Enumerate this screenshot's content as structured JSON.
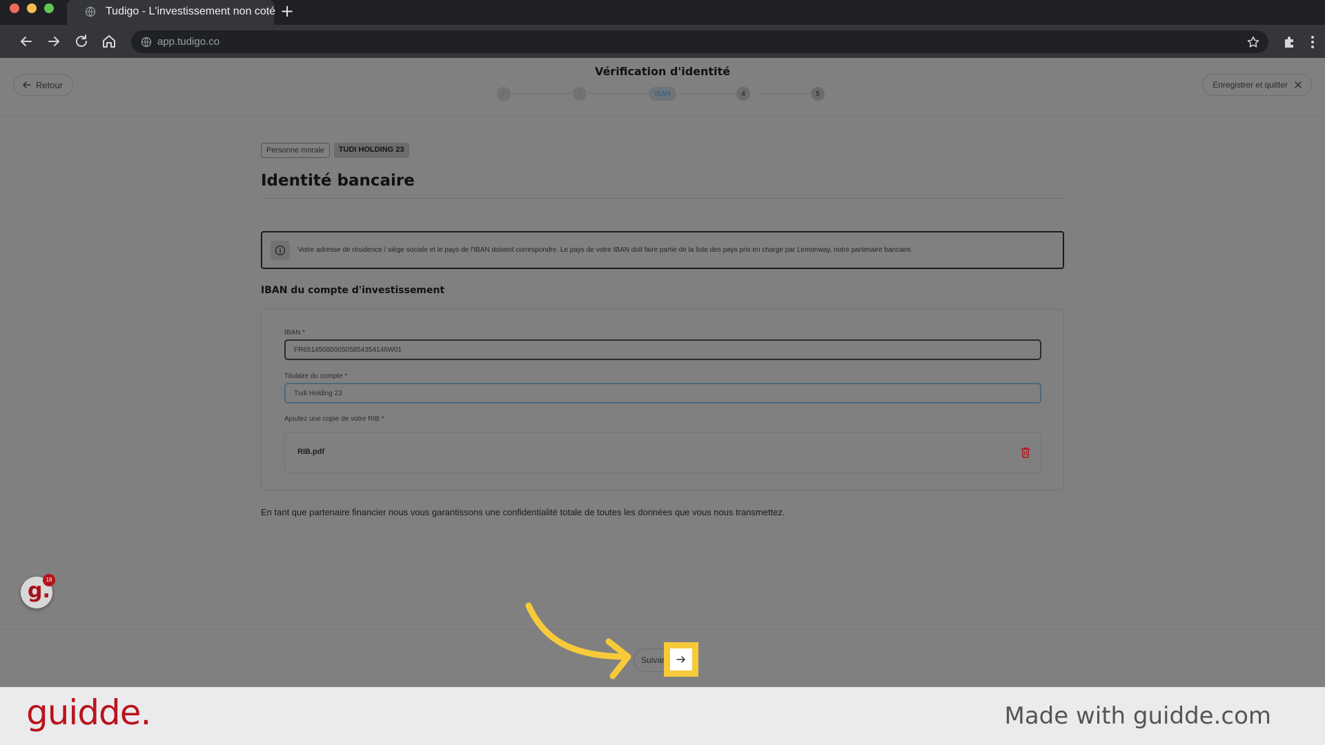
{
  "browser": {
    "tab_title": "Tudigo - L'investissement non coté",
    "new_tab_symbol": "+",
    "url": "app.tudigo.co"
  },
  "header": {
    "back_label": "Retour",
    "title": "Vérification d'identité",
    "save_quit_label": "Enregistrer et quitter",
    "steps": [
      {
        "label": "✓",
        "state": "done"
      },
      {
        "label": "✓",
        "state": "done"
      },
      {
        "label": "IBAN",
        "state": "current"
      },
      {
        "label": "4",
        "state": "todo"
      },
      {
        "label": "5",
        "state": "todo"
      }
    ]
  },
  "main": {
    "chip_type": "Personne morale",
    "chip_entity": "TUDI HOLDING 23",
    "section_title": "Identité bancaire",
    "info_text": "Votre adresse de résidence / siège sociale et le pays de l'IBAN doivent correspondre. Le pays de votre IBAN doit faire partie de la liste des pays pris en charge par Lemonway, notre partenaire bancaire.",
    "subsection_title": "IBAN du compte d'investissement",
    "iban_label": "IBAN *",
    "iban_value": "FR6514508000505854354146W01",
    "holder_label": "Titulaire du compte *",
    "holder_value": "Tudi Holding 23",
    "rib_label": "Ajoutez une copie de votre RIB *",
    "rib_file": "RIB.pdf",
    "footer_note": "En tant que partenaire financier nous vous garantissons une confidentialité totale de toutes les données que vous nous transmettez."
  },
  "bottom": {
    "next_label": "Suivant",
    "avatar_letter": "g.",
    "avatar_badge": "18"
  },
  "brand": {
    "logo": "guidde.",
    "made_with": "Made with guidde.com"
  },
  "colors": {
    "highlight": "#f7ca39",
    "brand_red": "#b9141d",
    "delete_red": "#b3121a"
  }
}
